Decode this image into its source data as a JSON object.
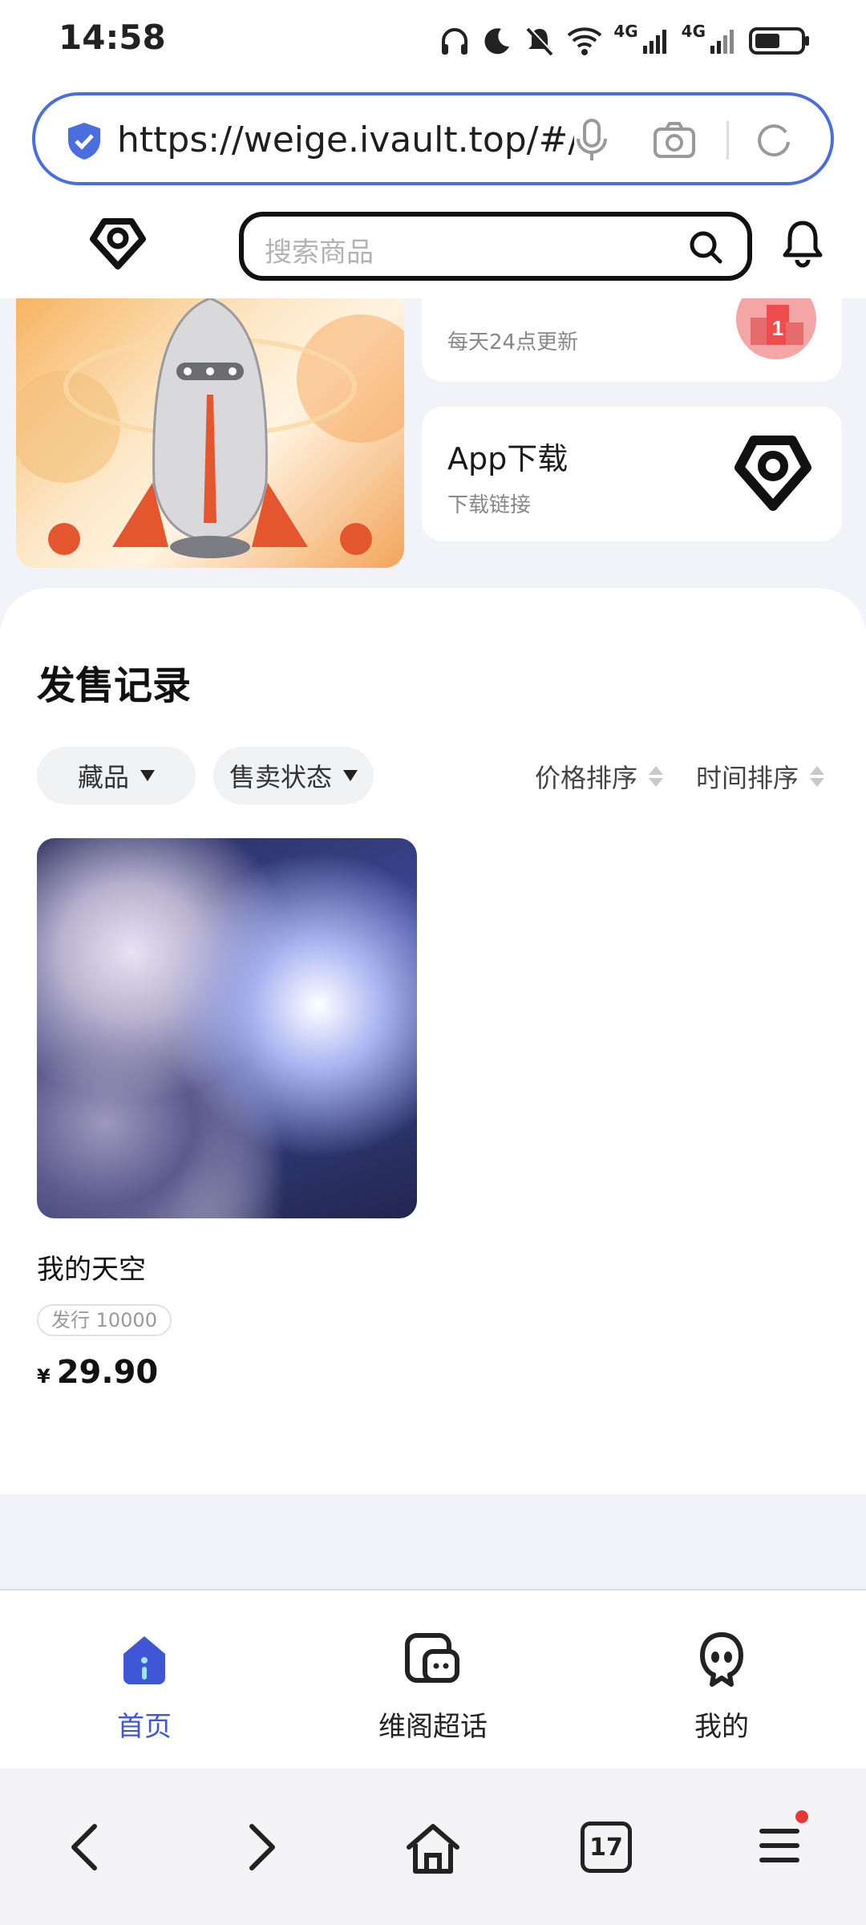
{
  "status_bar": {
    "time": "14:58",
    "net1": "4G",
    "net2": "4G"
  },
  "browser": {
    "url": "https://weige.ivault.top/#/"
  },
  "header": {
    "search_placeholder": "搜索商品"
  },
  "banner": {
    "ranking_card": {
      "subtitle": "每天24点更新",
      "badge": "1"
    },
    "app_card": {
      "title": "App下载",
      "subtitle": "下载链接"
    }
  },
  "sales": {
    "title": "发售记录",
    "filters": [
      {
        "label": "藏品"
      },
      {
        "label": "售卖状态"
      }
    ],
    "sorts": [
      {
        "label": "价格排序"
      },
      {
        "label": "时间排序"
      }
    ],
    "products": [
      {
        "name": "我的天空",
        "tag": "发行 10000",
        "currency": "¥",
        "price": "29.90"
      }
    ]
  },
  "bottom_nav": [
    {
      "label": "首页",
      "active": true
    },
    {
      "label": "维阁超话",
      "active": false
    },
    {
      "label": "我的",
      "active": false
    }
  ],
  "toolbar": {
    "tab_count": "17"
  },
  "colors": {
    "accent": "#3f56d6",
    "url_border": "#4a6ee0",
    "notification_dot": "#e53935"
  }
}
